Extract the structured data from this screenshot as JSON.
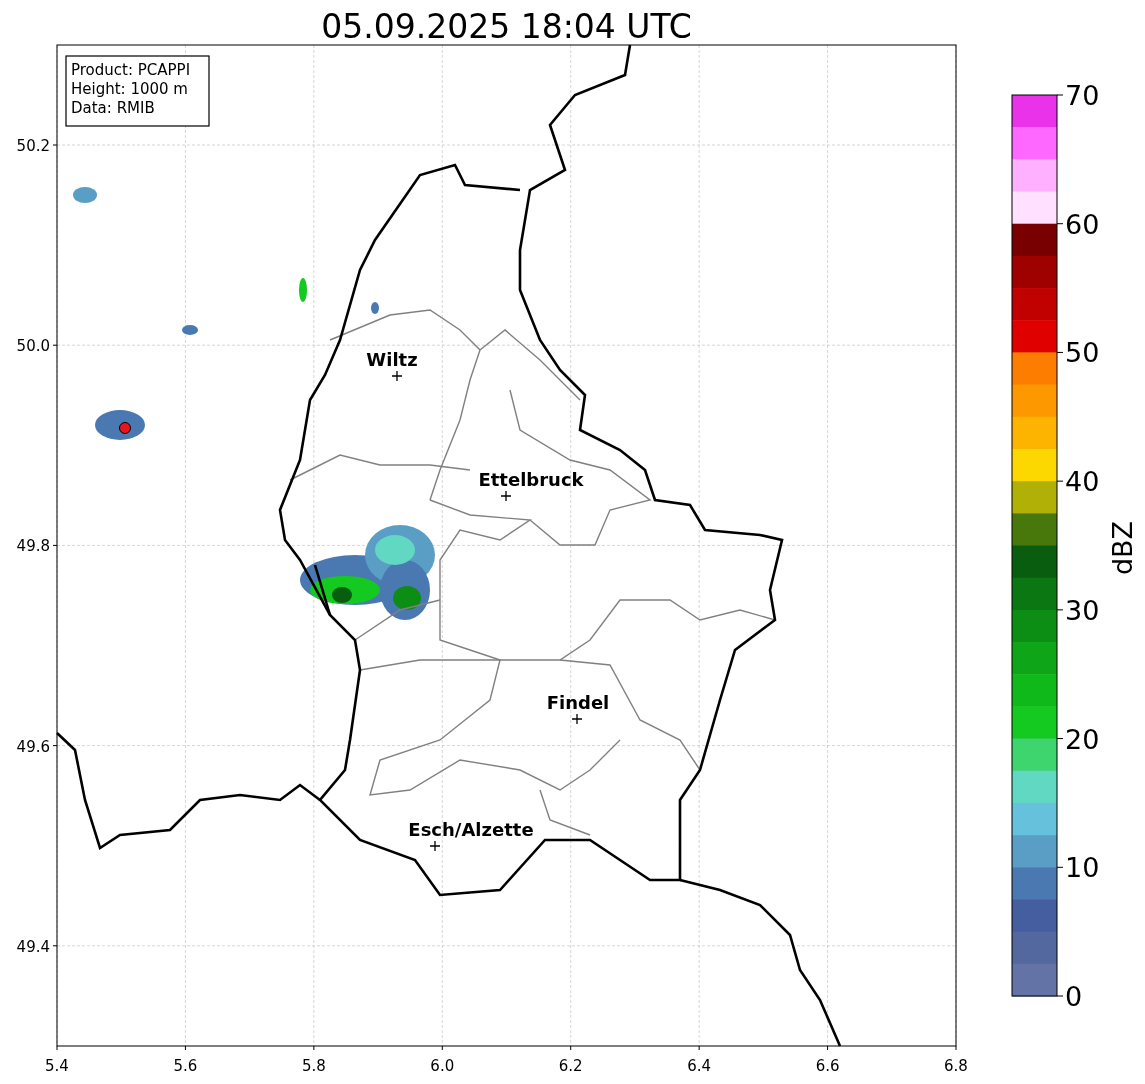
{
  "map": {
    "title": "05.09.2025 18:04 UTC",
    "xticks": [
      "5.4",
      "5.6",
      "5.8",
      "6.0",
      "6.2",
      "6.4",
      "6.6",
      "6.8"
    ],
    "yticks": [
      "50.2",
      "50.0",
      "49.8",
      "49.6",
      "49.4"
    ],
    "cities": [
      {
        "name": "Wiltz"
      },
      {
        "name": "Ettelbruck"
      },
      {
        "name": "Findel"
      },
      {
        "name": "Esch/Alzette"
      }
    ]
  },
  "info_box": [
    "Product: PCAPPI",
    "Height: 1000 m",
    "Data: RMIB"
  ],
  "colorbar": {
    "label": "dBZ",
    "ticks": [
      "70",
      "60",
      "50",
      "40",
      "30",
      "20",
      "10",
      "0"
    ],
    "bands": [
      {
        "color": "#ea32ea"
      },
      {
        "color": "#ff68ff"
      },
      {
        "color": "#ffb0ff"
      },
      {
        "color": "#ffe0ff"
      },
      {
        "color": "#780000"
      },
      {
        "color": "#9f0000"
      },
      {
        "color": "#c10000"
      },
      {
        "color": "#e10000"
      },
      {
        "color": "#fd7d00"
      },
      {
        "color": "#fd9800"
      },
      {
        "color": "#fdb400"
      },
      {
        "color": "#fdd800"
      },
      {
        "color": "#b0b006"
      },
      {
        "color": "#48780c"
      },
      {
        "color": "#085e0e"
      },
      {
        "color": "#0a7712"
      },
      {
        "color": "#0c8e15"
      },
      {
        "color": "#0ea618"
      },
      {
        "color": "#10b91a"
      },
      {
        "color": "#14c920"
      },
      {
        "color": "#3ed56f"
      },
      {
        "color": "#61d8c2"
      },
      {
        "color": "#66c1dc"
      },
      {
        "color": "#5a9ec6"
      },
      {
        "color": "#4a79b2"
      },
      {
        "color": "#445ea0"
      },
      {
        "color": "#5468a0"
      },
      {
        "color": "#6473a6"
      }
    ]
  }
}
